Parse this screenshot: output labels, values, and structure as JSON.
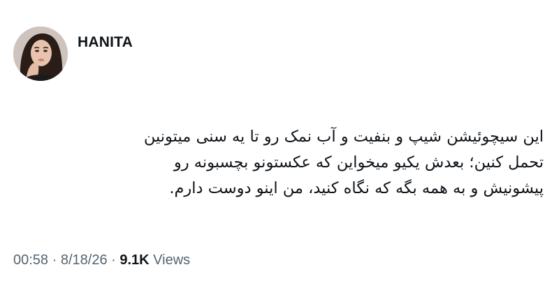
{
  "author": {
    "name": "HANITA"
  },
  "tweet": {
    "lines": [
      "این سیچوئیشن شیپ و بنفیت و آب نمک رو تا یه سنی میتونین",
      "تحمل کنین؛ بعدش یکیو میخواین که عکستونو بچسبونه رو",
      "پیشونیش و به همه بگه که نگاه کنید، من اینو دوست دارم."
    ]
  },
  "meta": {
    "time": "00:58",
    "separator_1": " · ",
    "date": "8/18/26",
    "separator_2": " · ",
    "views_count": "9.1K",
    "views_label": " Views"
  },
  "colors": {
    "text": "#0f1419",
    "secondary": "#536471",
    "background": "#ffffff"
  }
}
